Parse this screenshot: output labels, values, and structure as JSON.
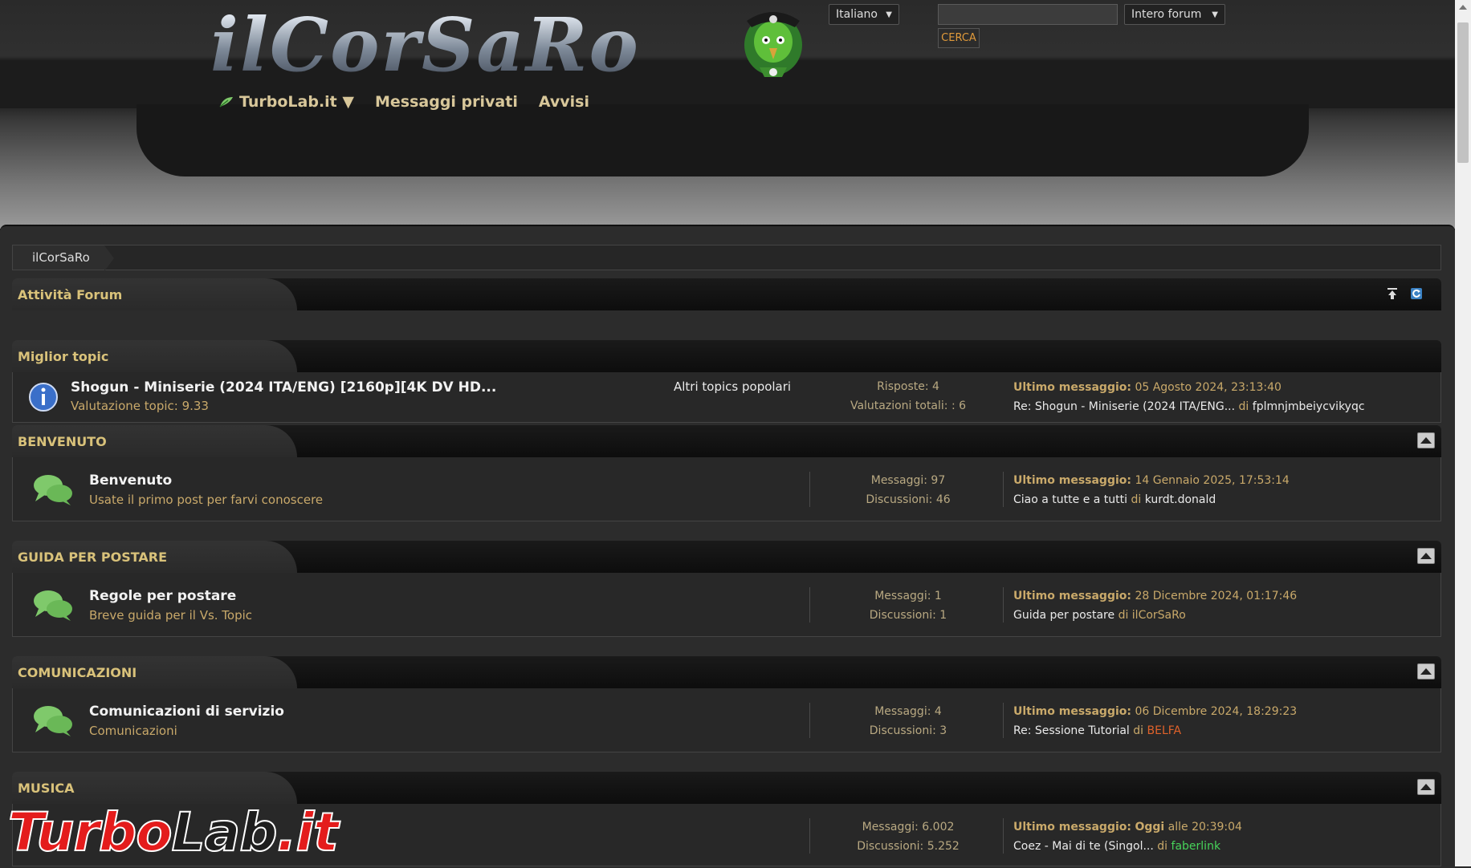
{
  "header": {
    "logo_text": "ilCorSaRo",
    "nav": [
      {
        "label": "TurboLab.it ▼"
      },
      {
        "label": "Messaggi privati"
      },
      {
        "label": "Avvisi"
      }
    ],
    "language": "Italiano",
    "search_value": "",
    "search_button": "CERCA",
    "search_scope": "Intero forum"
  },
  "breadcrumb": [
    "ilCorSaRo"
  ],
  "activity": {
    "title": "Attività Forum"
  },
  "top_topic": {
    "section": "Miglior topic",
    "title": "Shogun - Miniserie (2024 ITA/ENG) [2160p][4K DV HD...",
    "rating": "Valutazione topic: 9.33",
    "popular_link": "Altri topics popolari",
    "replies": "Risposte: 4",
    "votes": "Valutazioni totali: : 6",
    "last_label": "Ultimo messaggio:",
    "last_date": "05 Agosto 2024, 23:13:40",
    "last_subject": "Re: Shogun - Miniserie (2024 ITA/ENG...",
    "by": "di",
    "last_user": "fplmnjmbeiycvikyqc"
  },
  "sections": [
    {
      "name": "BENVENUTO",
      "board": "Benvenuto",
      "desc": "Usate il primo post per farvi conoscere",
      "posts": "Messaggi: 97",
      "topics": "Discussioni: 46",
      "last_date": "14 Gennaio 2025, 17:53:14",
      "last_subject": "Ciao a tutte e a tutti",
      "last_user": "kurdt.donald"
    },
    {
      "name": "GUIDA PER POSTARE",
      "board": "Regole per postare",
      "desc": "Breve guida per il Vs. Topic",
      "posts": "Messaggi: 1",
      "topics": "Discussioni: 1",
      "last_date": "28 Dicembre 2024, 01:17:46",
      "last_subject": "Guida per postare",
      "last_user": "ilCorSaRo"
    },
    {
      "name": "COMUNICAZIONI",
      "board": "Comunicazioni di servizio",
      "desc": "Comunicazioni",
      "posts": "Messaggi: 4",
      "topics": "Discussioni: 3",
      "last_date": "06 Dicembre 2024, 18:29:23",
      "last_subject": "Re: Sessione Tutorial",
      "last_user": "BELFA"
    },
    {
      "name": "MUSICA",
      "board": "",
      "desc": "",
      "posts": "Messaggi: 6.002",
      "topics": "Discussioni: 5.252",
      "last_date_prefix": "Oggi",
      "last_date": "alle 20:39:04",
      "last_subject": "Coez - Mai di te (Singol...",
      "last_user": "faberlink"
    }
  ],
  "labels": {
    "last": "Ultimo messaggio:",
    "by": "di"
  },
  "watermark": {
    "a": "Turbo",
    "b": "Lab",
    "c": ".it"
  },
  "colors": {
    "accent_gold": "#d9c27a",
    "orange": "#e0622a",
    "green": "#47d35a",
    "chat_icon": "#7fc96b"
  }
}
